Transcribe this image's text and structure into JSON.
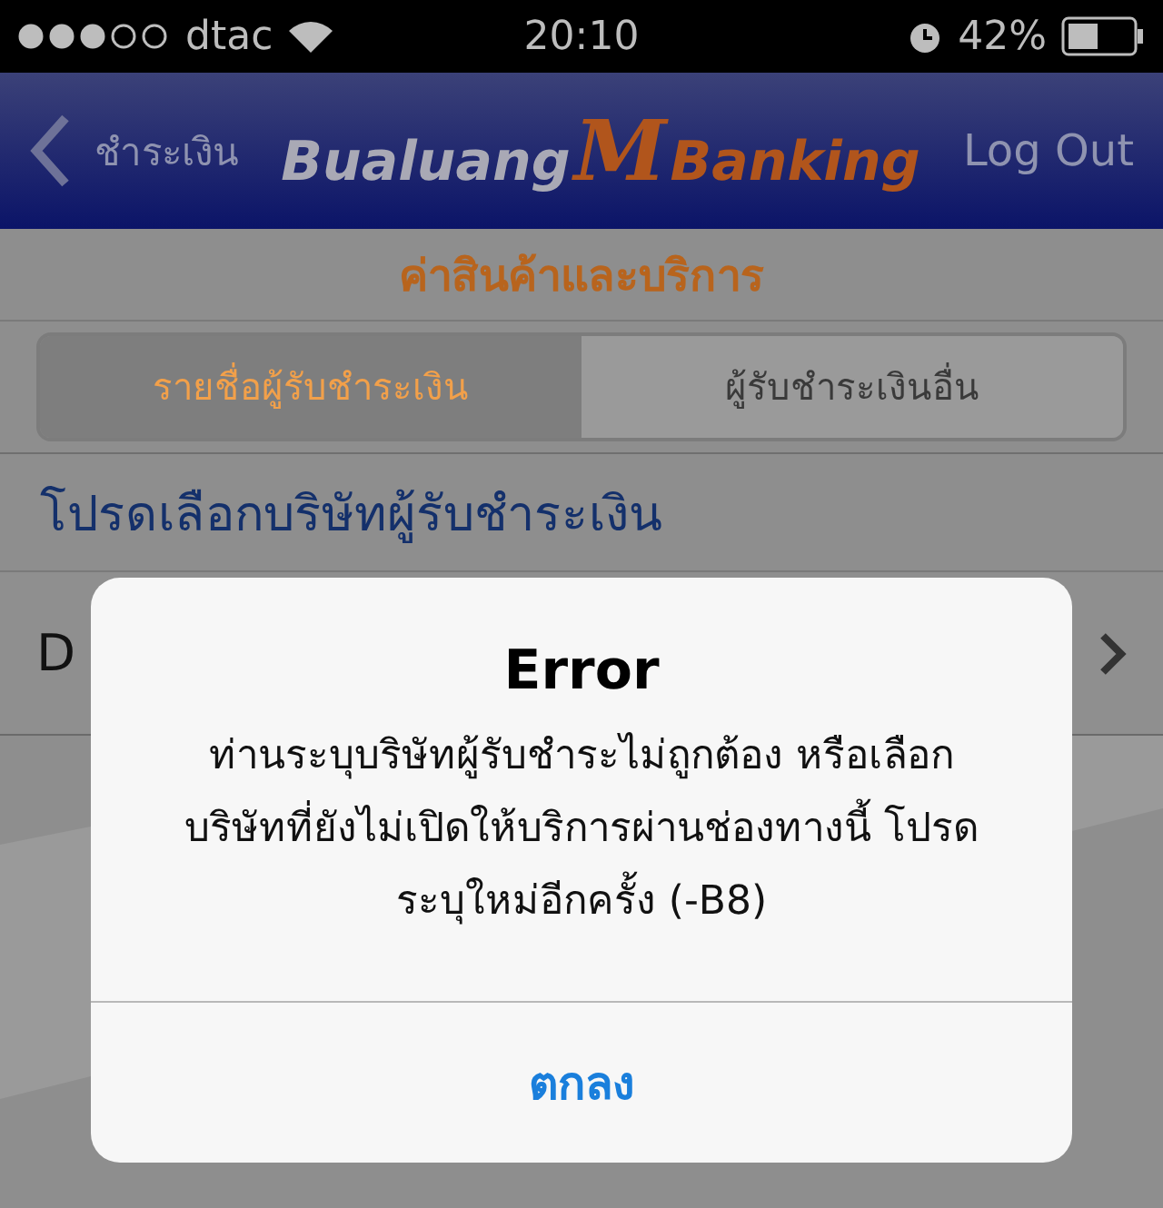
{
  "status_bar": {
    "carrier": "dtac",
    "time": "20:10",
    "battery": "42%"
  },
  "nav_bar": {
    "back": "ชำระเงิน",
    "logo": [
      "Bualuang",
      "M",
      "Banking"
    ],
    "action": "Log Out"
  },
  "page_title": "ค่าสินค้าและบริการ",
  "tabs": [
    {
      "label": "รายชื่อผู้รับชำระเงิน",
      "selected": true
    },
    {
      "label": "ผู้รับชำระเงินอื่น",
      "selected": false
    }
  ],
  "section_header": "โปรดเลือกบริษัทผู้รับชำระเงิน",
  "rows": [
    {
      "label": "D"
    }
  ],
  "alert": {
    "title": "Error",
    "message": "ท่านระบุบริษัทผู้รับชำระไม่ถูกต้อง หรือเลือกบริษัทที่ยังไม่เปิดให้บริการผ่านช่องทางนี้ โปรดระบุใหม่อีกครั้ง (-B8)",
    "button": "ตกลง"
  }
}
